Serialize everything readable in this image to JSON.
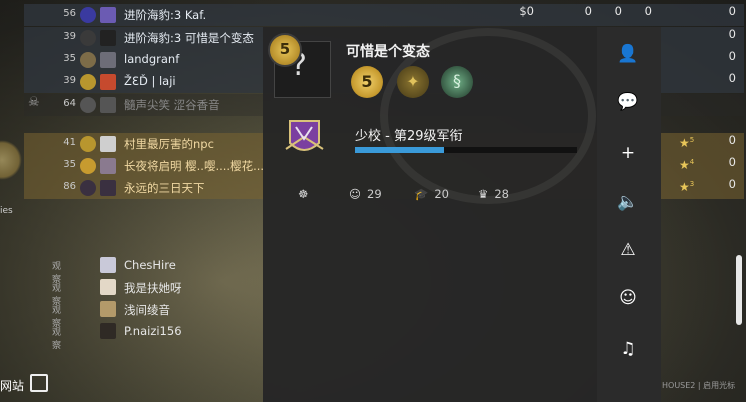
{
  "scoreboard": {
    "rows": [
      {
        "team": "ct",
        "score": "56",
        "name": "进阶海豹:3 Kaf.",
        "money": "$0",
        "k": "0",
        "a": "0",
        "d": "0",
        "mvp": "0",
        "avatar_color": "#6b5bb3",
        "rank_color": "#3a3aa0"
      },
      {
        "team": "ct",
        "score": "39",
        "name": "进阶海豹:3 可惜是个变态",
        "money": "",
        "k": "",
        "a": "",
        "d": "",
        "mvp": "0",
        "avatar_color": "#222222",
        "rank_color": "#3a3a3a"
      },
      {
        "team": "ct",
        "score": "35",
        "name": "landgranf",
        "money": "",
        "k": "",
        "a": "",
        "d": "",
        "mvp": "0",
        "avatar_color": "#6d6d78",
        "rank_color": "#7d6c48"
      },
      {
        "team": "ct",
        "score": "39",
        "name": "ŽƐĎ | laji",
        "money": "",
        "k": "",
        "a": "",
        "d": "",
        "mvp": "0",
        "avatar_color": "#c64a2e",
        "rank_color": "#b8962e"
      },
      {
        "team": "dead",
        "score": "64",
        "name": "髓声尖笑 涩谷香音",
        "money": "",
        "k": "",
        "a": "",
        "d": "",
        "mvp": "",
        "avatar_color": "#555555",
        "rank_color": "#555555"
      },
      {
        "team": "t",
        "score": "41",
        "name": "村里最厉害的npc",
        "money": "",
        "k": "",
        "a": "",
        "d": "",
        "mvp": "0",
        "star": "5",
        "avatar_color": "#cfcfcf",
        "rank_color": "#b8962e"
      },
      {
        "team": "t",
        "score": "35",
        "name": "长夜将启明 樱..嘤....樱花...",
        "money": "",
        "k": "",
        "a": "",
        "d": "",
        "mvp": "0",
        "star": "4",
        "avatar_color": "#8a7a8f",
        "rank_color": "#c79b2f"
      },
      {
        "team": "t",
        "score": "86",
        "name": "永远的三日天下",
        "money": "",
        "k": "",
        "a": "",
        "d": "",
        "mvp": "0",
        "star": "3",
        "avatar_color": "#3a3040",
        "rank_color": "#3a3040"
      }
    ]
  },
  "spectators": {
    "tag": "观察",
    "list": [
      {
        "name": "ChesHire",
        "avatar_color": "#c9c9d9"
      },
      {
        "name": "我是扶她呀",
        "avatar_color": "#e3d8c7"
      },
      {
        "name": "浅间绫音",
        "avatar_color": "#b39a6a"
      },
      {
        "name": "P.naizi156",
        "avatar_color": "#2f2a25"
      }
    ]
  },
  "left": {
    "emblem_text": "ies",
    "website_label": "网站"
  },
  "popup": {
    "player_name": "可惜是个变态",
    "rank_badge": "5",
    "rank_text": "少校 - 第29级军衔",
    "progress_fraction": 0.4,
    "medals": [
      {
        "name": "service-medal",
        "glyph": "5"
      },
      {
        "name": "wing-medal",
        "glyph": "✦"
      },
      {
        "name": "snake-medal",
        "glyph": "§"
      }
    ],
    "stats": [
      {
        "icon": "wolf-icon",
        "value": ""
      },
      {
        "icon": "smile-icon",
        "value": "29"
      },
      {
        "icon": "graduation-cap-icon",
        "value": "20"
      },
      {
        "icon": "crown-icon",
        "value": "28"
      }
    ]
  },
  "side_menu": {
    "items": [
      {
        "name": "profile-icon",
        "glyph": "👤"
      },
      {
        "name": "message-icon",
        "glyph": "💬"
      },
      {
        "name": "add-friend-icon",
        "glyph": "+"
      },
      {
        "name": "mute-icon",
        "glyph": "🔈"
      },
      {
        "name": "report-icon",
        "glyph": "⚠"
      },
      {
        "name": "commend-icon",
        "glyph": "☺"
      },
      {
        "name": "music-icon",
        "glyph": "♫"
      }
    ]
  },
  "bottom_right_text": "HOUSE2 | 启用光标"
}
